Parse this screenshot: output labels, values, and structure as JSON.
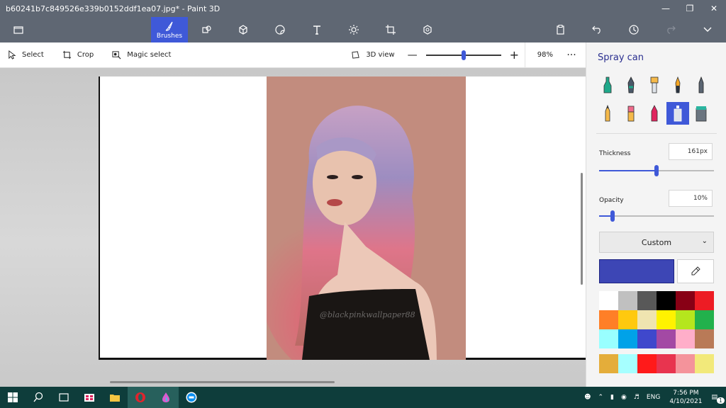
{
  "window": {
    "title": "b60241b7c849526e339b0152ddf1ea07.jpg* - Paint 3D"
  },
  "ribbon": {
    "active_label": "Brushes"
  },
  "command_bar": {
    "select": "Select",
    "crop": "Crop",
    "magic_select": "Magic select",
    "view_3d": "3D view",
    "zoom": "98%",
    "zoom_level": 0.5,
    "more": "···"
  },
  "canvas": {
    "watermark": "@blackpinkwallpaper88"
  },
  "panel": {
    "title": "Spray can",
    "brushes": [
      "marker",
      "calligraphy-pen",
      "oil-brush",
      "watercolor",
      "pixel-pen",
      "pencil",
      "eraser",
      "crayon",
      "spray-can",
      "fill"
    ],
    "selected_brush": "spray-can",
    "thickness_label": "Thickness",
    "thickness_value": "161px",
    "thickness_level": 0.5,
    "opacity_label": "Opacity",
    "opacity_value": "10%",
    "opacity_level": 0.1,
    "color_mode": "Custom",
    "current_color": "#3d46b5",
    "swatches": [
      "#ffffff",
      "#c0c0c0",
      "#585858",
      "#000000",
      "#880015",
      "#ed1c24",
      "#ff7f27",
      "#ffc90e",
      "#efe4b0",
      "#fff200",
      "#b5e61d",
      "#22b14c",
      "#99ffff",
      "#00a2e8",
      "#3f48cc",
      "#a349a4",
      "#ffaec9",
      "#b97a57"
    ],
    "custom_swatches": [
      "#e4ad3a",
      "#a6ffff",
      "#ff1a1a",
      "#e8344f",
      "#f4939b",
      "#f2e97a"
    ]
  },
  "taskbar": {
    "language": "ENG",
    "time": "7:56 PM",
    "date": "4/10/2021",
    "notifications": "1"
  }
}
